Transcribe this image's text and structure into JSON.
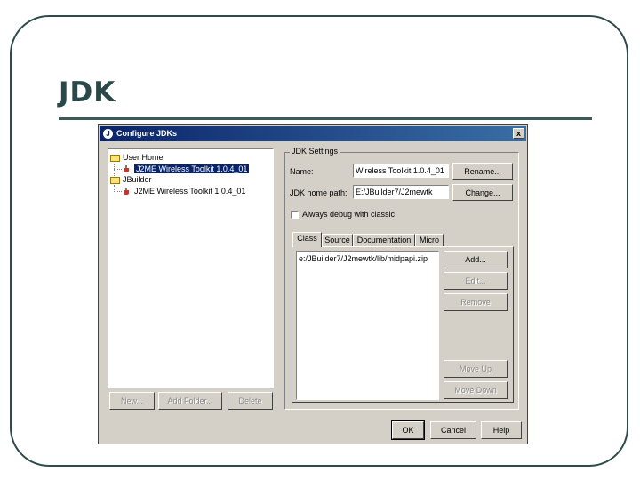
{
  "slide": {
    "title": "JDK"
  },
  "dialog": {
    "title": "Configure JDKs",
    "close_label": "x",
    "tree": {
      "user_home": "User Home",
      "user_home_child": "J2ME Wireless Toolkit 1.0.4_01",
      "jbuilder": "JBuilder",
      "jbuilder_child": "J2ME Wireless Toolkit 1.0.4_01"
    },
    "left_buttons": {
      "new": "New...",
      "add_folder": "Add Folder...",
      "delete": "Delete"
    },
    "settings": {
      "group_label": "JDK Settings",
      "name_label": "Name:",
      "name_value": "Wireless Toolkit 1.0.4_01",
      "rename": "Rename...",
      "home_label": "JDK home path:",
      "home_value": "E:/JBuilder7/J2mewtk",
      "change": "Change...",
      "always_debug": "Always debug with classic"
    },
    "tabs": [
      "Class",
      "Source",
      "Documentation",
      "Micro"
    ],
    "classpath_items": [
      "e:/JBuilder7/J2mewtk/lib/midpapi.zip"
    ],
    "list_buttons": {
      "add": "Add...",
      "edit": "Edit...",
      "remove": "Remove",
      "move_up": "Move Up",
      "move_down": "Move Down"
    },
    "footer": {
      "ok": "OK",
      "cancel": "Cancel",
      "help": "Help"
    }
  },
  "colors": {
    "titlebar_start": "#0a246a",
    "titlebar_end": "#3a6ea5",
    "slide_title": "#2b4848",
    "dialog_face": "#d4d0c8"
  }
}
